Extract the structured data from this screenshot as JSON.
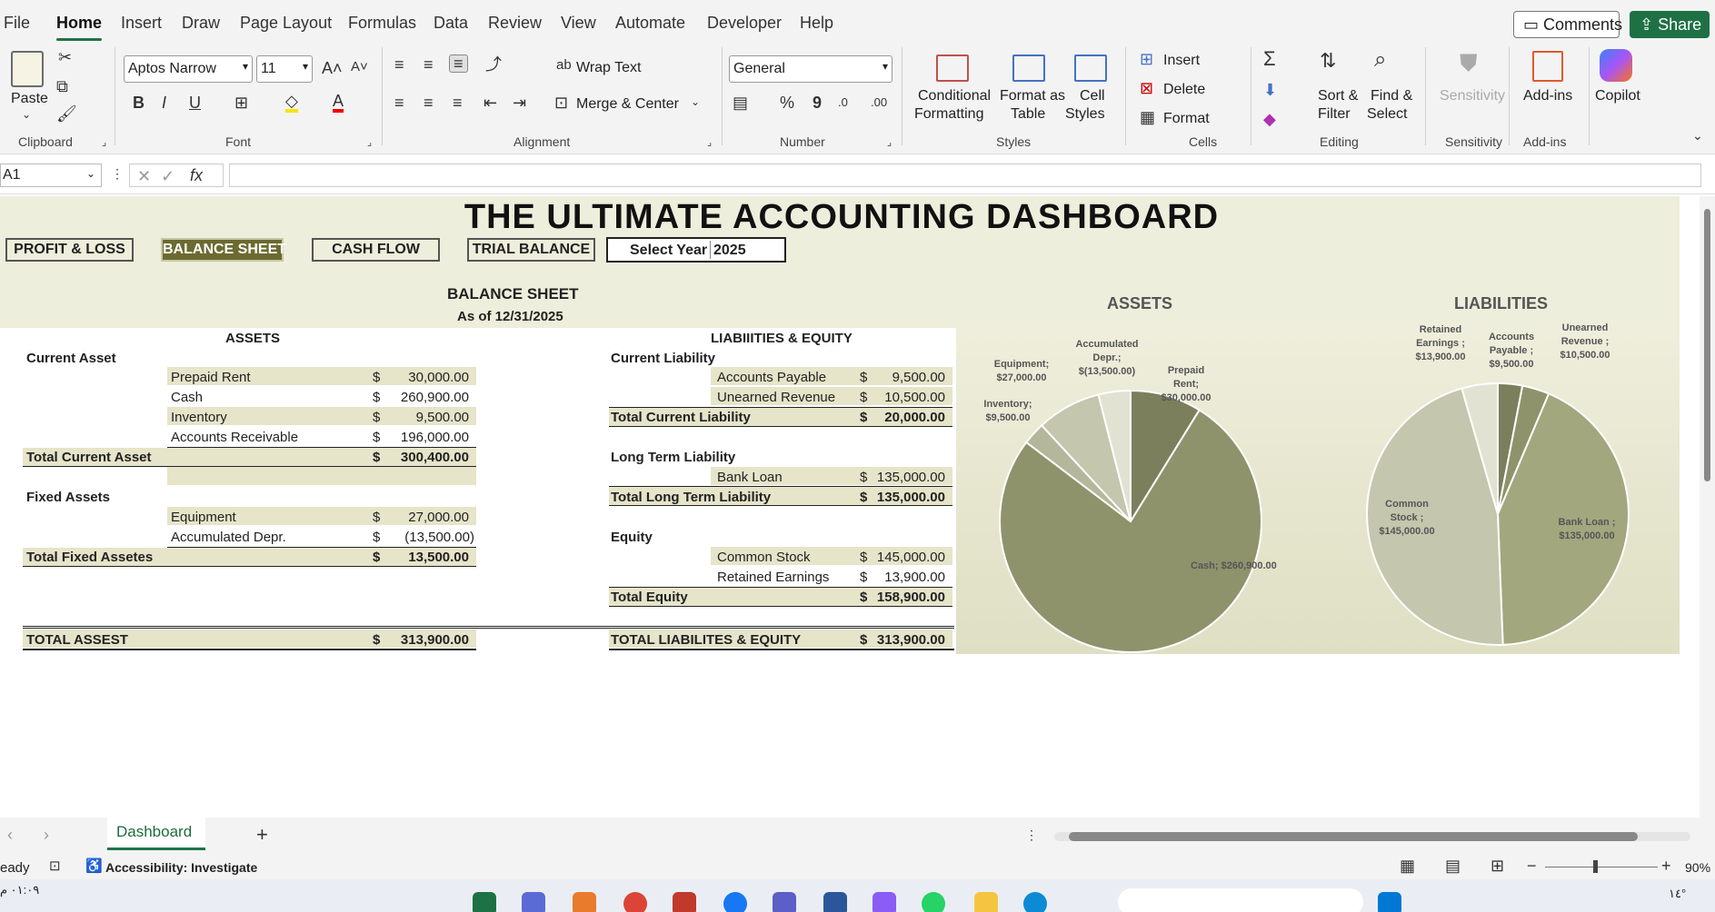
{
  "menu": {
    "tabs": [
      "File",
      "Home",
      "Insert",
      "Draw",
      "Page Layout",
      "Formulas",
      "Data",
      "Review",
      "View",
      "Automate",
      "Developer",
      "Help"
    ],
    "active_tab": "Home",
    "comments_label": "Comments",
    "share_label": "Share"
  },
  "ribbon": {
    "clipboard": {
      "paste_label": "Paste",
      "group_label": "Clipboard"
    },
    "font": {
      "family": "Aptos Narrow",
      "size": "11",
      "group_label": "Font"
    },
    "alignment": {
      "wrap_text": "Wrap Text",
      "merge_center": "Merge & Center",
      "group_label": "Alignment"
    },
    "number": {
      "format": "General",
      "group_label": "Number"
    },
    "styles": {
      "conditional_1": "Conditional",
      "conditional_2": "Formatting",
      "format_table_1": "Format as",
      "format_table_2": "Table",
      "cell_styles_1": "Cell",
      "cell_styles_2": "Styles",
      "group_label": "Styles"
    },
    "cells": {
      "insert": "Insert",
      "delete": "Delete",
      "format": "Format",
      "group_label": "Cells"
    },
    "editing": {
      "sort_1": "Sort &",
      "sort_2": "Filter",
      "find_1": "Find &",
      "find_2": "Select",
      "group_label": "Editing"
    },
    "sensitivity": {
      "label": "Sensitivity",
      "group_label": "Sensitivity"
    },
    "addins": {
      "label": "Add-ins",
      "group_label": "Add-ins"
    },
    "copilot": {
      "label": "Copilot"
    }
  },
  "formula_bar": {
    "name_box": "A1",
    "fx": "fx",
    "formula": ""
  },
  "dashboard": {
    "title": "THE ULTIMATE ACCOUNTING DASHBOARD",
    "nav_buttons": [
      "PROFIT & LOSS",
      "BALANCE SHEET",
      "CASH FLOW",
      "TRIAL BALANCE"
    ],
    "active_nav": "BALANCE SHEET",
    "select_year_label": "Select Year",
    "select_year_value": "2025",
    "sheet_title": "BALANCE SHEET",
    "sheet_date": "As of 12/31/2025",
    "assets": {
      "header": "ASSETS",
      "current_label": "Current Asset",
      "current_items": [
        {
          "name": "Prepaid Rent",
          "cur": "$",
          "amount": "30,000.00"
        },
        {
          "name": "Cash",
          "cur": "$",
          "amount": "260,900.00"
        },
        {
          "name": "Inventory",
          "cur": "$",
          "amount": "9,500.00"
        },
        {
          "name": "Accounts Receivable",
          "cur": "$",
          "amount": "196,000.00"
        }
      ],
      "total_current": {
        "name": "Total Current Asset",
        "cur": "$",
        "amount": "300,400.00"
      },
      "fixed_label": "Fixed Assets",
      "fixed_items": [
        {
          "name": "Equipment",
          "cur": "$",
          "amount": "27,000.00"
        },
        {
          "name": "Accumulated Depr.",
          "cur": "$",
          "amount": "(13,500.00)"
        }
      ],
      "total_fixed": {
        "name": "Total Fixed Assetes",
        "cur": "$",
        "amount": "13,500.00"
      },
      "total": {
        "name": "TOTAL ASSEST",
        "cur": "$",
        "amount": "313,900.00"
      }
    },
    "liabilities": {
      "header": "LIABIIITIES & EQUITY",
      "current_label": "Current Liability",
      "current_items": [
        {
          "name": "Accounts Payable",
          "cur": "$",
          "amount": "9,500.00"
        },
        {
          "name": "Unearned Revenue",
          "cur": "$",
          "amount": "10,500.00"
        }
      ],
      "total_current": {
        "name": "Total Current Liability",
        "cur": "$",
        "amount": "20,000.00"
      },
      "long_label": "Long Term Liability",
      "long_items": [
        {
          "name": "Bank Loan",
          "cur": "$",
          "amount": "135,000.00"
        }
      ],
      "total_long": {
        "name": "Total Long Term Liability",
        "cur": "$",
        "amount": "135,000.00"
      },
      "equity_label": "Equity",
      "equity_items": [
        {
          "name": "Common Stock",
          "cur": "$",
          "amount": "145,000.00"
        },
        {
          "name": "Retained Earnings",
          "cur": "$",
          "amount": "13,900.00"
        }
      ],
      "total_equity": {
        "name": "Total Equity",
        "cur": "$",
        "amount": "158,900.00"
      },
      "total": {
        "name": "TOTAL LIABILITES & EQUITY",
        "cur": "$",
        "amount": "313,900.00"
      }
    }
  },
  "chart_data": [
    {
      "type": "pie",
      "title": "ASSETS",
      "categories": [
        "Prepaid Rent",
        "Cash",
        "Inventory",
        "Equipment",
        "Accumulated Depr."
      ],
      "values": [
        30000,
        260900,
        9500,
        27000,
        -13500
      ],
      "labels": [
        "Prepaid Rent; $30,000.00",
        "Cash; $260,900.00",
        "Inventory; $9,500.00",
        "Equipment; $27,000.00",
        "Accumulated Depr.; $(13,500.00)"
      ],
      "colors": [
        "#7b7f5c",
        "#8f936c",
        "#b4b79a",
        "#c4c6ad",
        "#e2e2d3"
      ]
    },
    {
      "type": "pie",
      "title": "LIABILITIES",
      "categories": [
        "Accounts Payable",
        "Unearned Revenue",
        "Bank Loan",
        "Common Stock",
        "Retained Earnings"
      ],
      "values": [
        9500,
        10500,
        135000,
        145000,
        13900
      ],
      "labels": [
        "Accounts Payable ; $9,500.00",
        "Unearned Revenue ; $10,500.00",
        "Bank Loan ; $135,000.00",
        "Common Stock ; $145,000.00",
        "Retained Earnings ; $13,900.00"
      ],
      "colors": [
        "#7b7f5c",
        "#8f936c",
        "#a3a77e",
        "#c4c6ad",
        "#e2e2d3"
      ]
    }
  ],
  "sheet_tab": "Dashboard",
  "status": {
    "ready": "eady",
    "accessibility": "Accessibility: Investigate",
    "zoom": "90%"
  },
  "taskbar": {
    "time": "٠١:٠٩ م",
    "temp": "١٤°"
  }
}
